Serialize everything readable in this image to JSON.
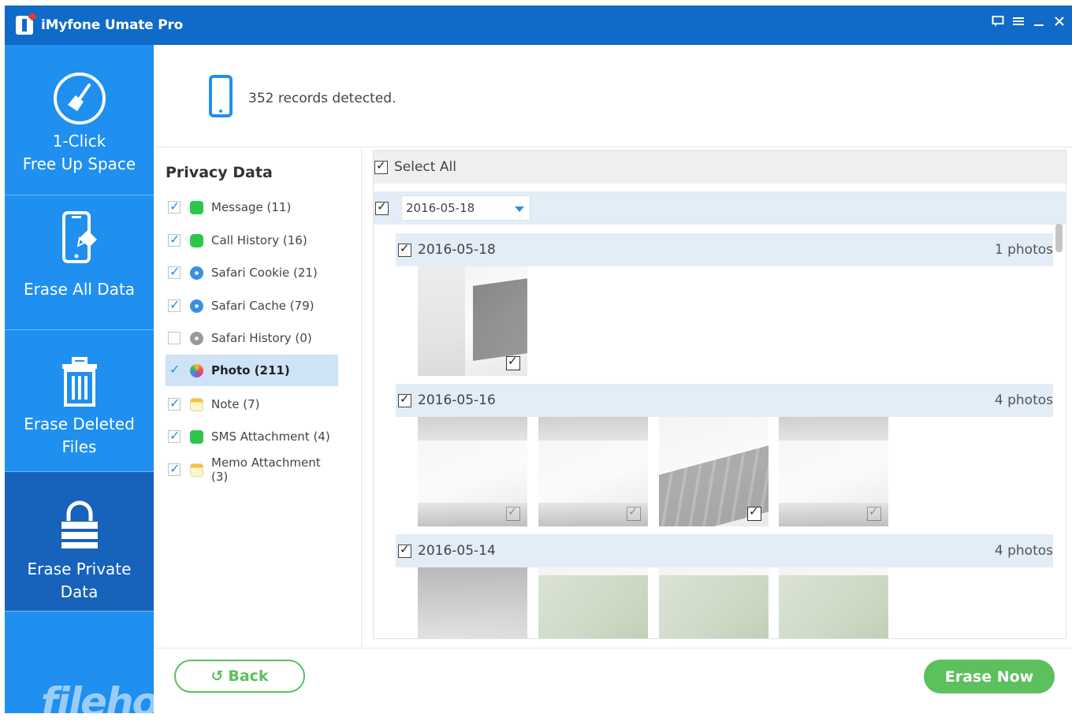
{
  "window": {
    "title": "iMyfone Umate Pro",
    "controls": [
      "feedback",
      "menu",
      "minimize",
      "close"
    ]
  },
  "sidebar": {
    "items": [
      {
        "label_line1": "1-Click",
        "label_line2": "Free Up Space",
        "icon": "broom-icon",
        "active": false
      },
      {
        "label_line1": "Erase All Data",
        "label_line2": "",
        "icon": "phone-erase-icon",
        "active": false
      },
      {
        "label_line1": "Erase Deleted",
        "label_line2": "Files",
        "icon": "trash-icon",
        "active": false
      },
      {
        "label_line1": "Erase Private",
        "label_line2": "Data",
        "icon": "lock-icon",
        "active": true
      }
    ],
    "watermark": "filehorse.com"
  },
  "header": {
    "records_text": "352 records detected."
  },
  "privacy": {
    "title": "Privacy Data",
    "items": [
      {
        "label": "Message (11)",
        "checked": true,
        "icon": "message-icon"
      },
      {
        "label": "Call History (16)",
        "checked": true,
        "icon": "phone-call-icon"
      },
      {
        "label": "Safari Cookie (21)",
        "checked": true,
        "icon": "safari-icon"
      },
      {
        "label": "Safari Cache (79)",
        "checked": true,
        "icon": "safari-icon"
      },
      {
        "label": "Safari History (0)",
        "checked": false,
        "icon": "safari-history-icon"
      },
      {
        "label": "Photo (211)",
        "checked": true,
        "icon": "photos-icon",
        "selected": true
      },
      {
        "label": "Note (7)",
        "checked": true,
        "icon": "note-icon"
      },
      {
        "label": "SMS Attachment (4)",
        "checked": true,
        "icon": "message-icon"
      },
      {
        "label": "Memo Attachment (3)",
        "checked": true,
        "icon": "note-icon"
      }
    ]
  },
  "photos": {
    "select_all_label": "Select All",
    "date_filter_value": "2016-05-18",
    "groups": [
      {
        "date": "2016-05-18",
        "count": "1 photos"
      },
      {
        "date": "2016-05-16",
        "count": "4 photos"
      },
      {
        "date": "2016-05-14",
        "count": "4 photos"
      }
    ]
  },
  "footer": {
    "back_label": "Back",
    "erase_label": "Erase Now",
    "accent": "#5cc05c"
  },
  "colors": {
    "titlebar": "#0f6ac8",
    "sidebar": "#1f8ff0",
    "sidebar_active": "#1762bb",
    "selection": "#cfe3f7"
  }
}
